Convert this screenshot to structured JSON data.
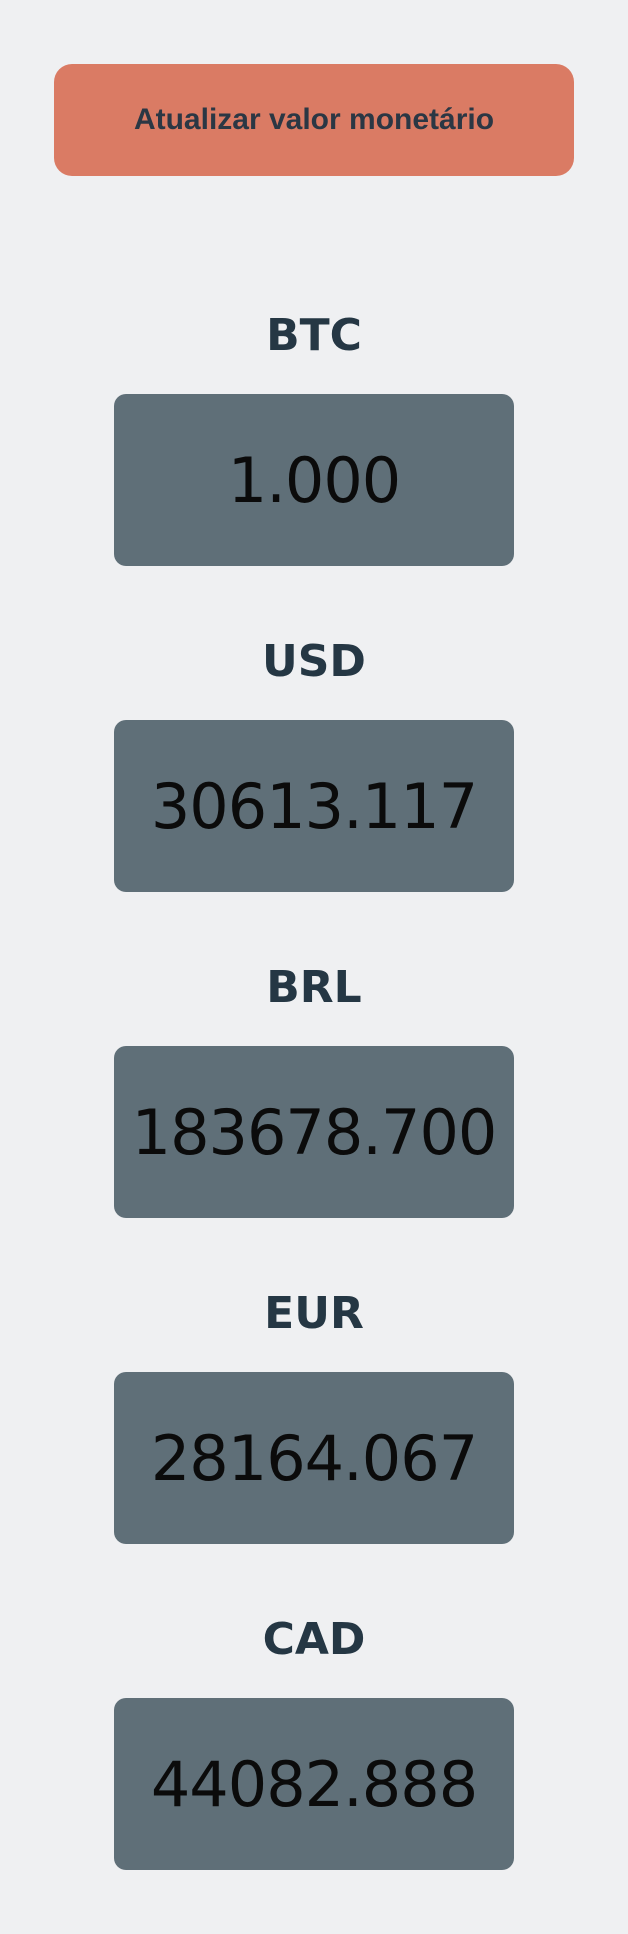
{
  "button": {
    "label": "Atualizar valor monetário",
    "color": "#da7b64"
  },
  "currencies": [
    {
      "code": "BTC",
      "value": "1.000"
    },
    {
      "code": "USD",
      "value": "30613.117"
    },
    {
      "code": "BRL",
      "value": "183678.700"
    },
    {
      "code": "EUR",
      "value": "28164.067"
    },
    {
      "code": "CAD",
      "value": "44082.888"
    }
  ],
  "colors": {
    "background": "#eff0f2",
    "value_box": "#5f6f78",
    "code_text": "#253744"
  }
}
